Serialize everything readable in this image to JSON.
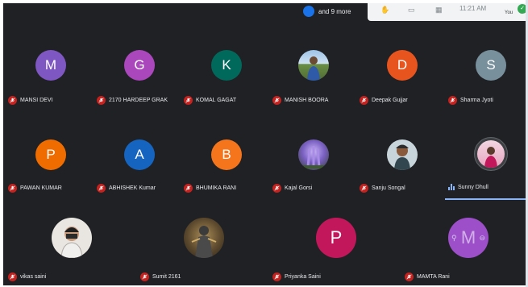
{
  "top": {
    "more_label": "and 9 more",
    "time": "11:21 AM",
    "you_label": "You"
  },
  "participants": [
    {
      "name": "MANSI DEVI",
      "initial": "M",
      "color": "#7e57c2"
    },
    {
      "name": "2170 HARDEEP GRAK",
      "initial": "G",
      "color": "#ab47bc"
    },
    {
      "name": "KOMAL GAGAT",
      "initial": "K",
      "color": "#00695c"
    },
    {
      "name": "MANISH BOORA",
      "initial": "",
      "color": "#6d8b4f"
    },
    {
      "name": "Deepak Gujjar",
      "initial": "D",
      "color": "#e8541e"
    },
    {
      "name": "Sharma Jyoti",
      "initial": "S",
      "color": "#78909c"
    },
    {
      "name": "PAWAN KUMAR",
      "initial": "P",
      "color": "#ef6c00"
    },
    {
      "name": "ABHISHEK Kumar",
      "initial": "A",
      "color": "#1565c0"
    },
    {
      "name": "BHUMIKA RANI",
      "initial": "B",
      "color": "#f4751c"
    },
    {
      "name": "Kajal Gorsi",
      "initial": "",
      "color": "#5b4a9e"
    },
    {
      "name": "Sanju Songal",
      "initial": "",
      "color": "#b9cbd1"
    },
    {
      "name": "Sunny Dhull",
      "initial": "",
      "color": "#c2185b"
    },
    {
      "name": "vikas saini",
      "initial": "",
      "color": "#d7d2cf"
    },
    {
      "name": "Sumit 2161",
      "initial": "",
      "color": "#5d4a2e"
    },
    {
      "name": "Priyanka Saini",
      "initial": "P",
      "color": "#c2185b"
    },
    {
      "name": "MAMTA Rani",
      "initial": "M",
      "color": "#9c4fc9"
    }
  ]
}
